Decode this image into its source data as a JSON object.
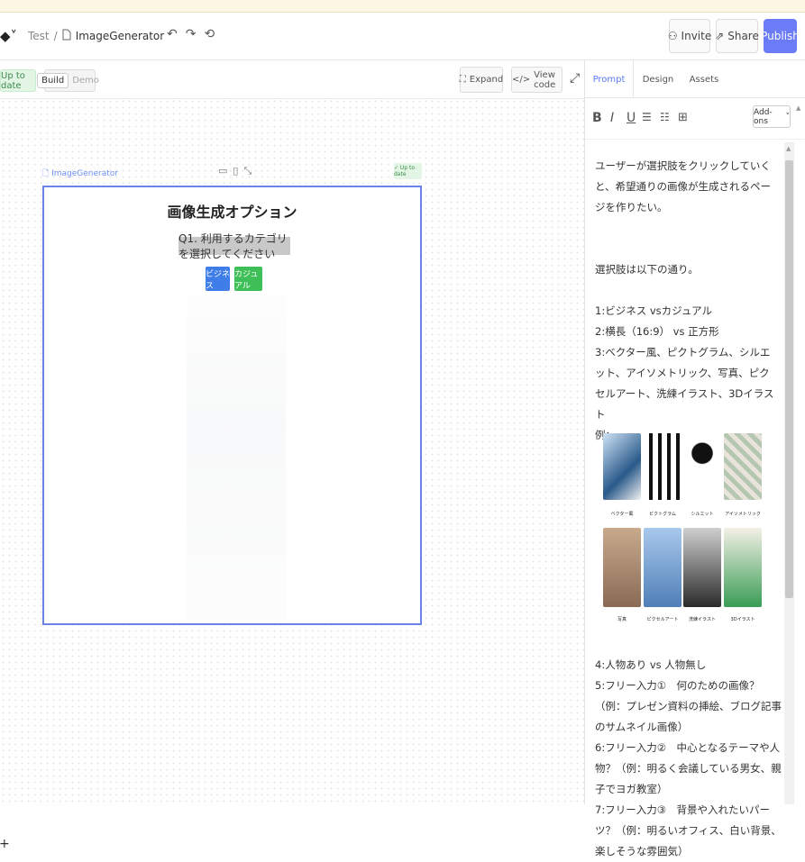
{
  "topbar": {
    "breadcrumb_root": "Test",
    "breadcrumb_sep": "/",
    "project_name": "ImageGenerator",
    "invite_label": "Invite",
    "share_label": "Share",
    "publish_label": "Publish"
  },
  "subbar": {
    "status_label": "Up to date",
    "mode_build": "Build",
    "mode_demo": "Demo",
    "expand_label": "Expand",
    "view_code_label": "View code"
  },
  "frame": {
    "name": "ImageGenerator",
    "badge": "✓ Up to date",
    "title": "画像生成オプション",
    "question": "Q1. 利用するカテゴリを選択してください",
    "choice_business": "ビジネス",
    "choice_casual": "カジュアル"
  },
  "panel": {
    "tabs": [
      "Prompt",
      "Design",
      "Assets"
    ],
    "addons_label": "Add-ons",
    "prompt_lines": [
      "ユーザーが選択肢をクリックしていくと、希望通りの画像が生成されるページを作りたい。",
      "",
      "",
      "選択肢は以下の通り。",
      "",
      "1:ビジネス vsカジュアル",
      "2:横長（16:9） vs 正方形",
      "3:ベクター風、ピクトグラム、シルエット、アイソメトリック、写真、ピクセルアート、洗練イラスト、3Dイラスト",
      "例："
    ],
    "image_captions": [
      "ベクター風",
      "ピクトグラム",
      "シルエット",
      "アイソメトリック",
      "写真",
      "ピクセルアート",
      "洗練イラスト",
      "3Dイラスト"
    ],
    "bottom_lines": [
      "4:人物あり vs 人物無し",
      "5:フリー入力①　何のための画像？　（例：プレゼン資料の挿絵、ブログ記事のサムネイル画像）",
      "6:フリー入力②　中心となるテーマや人物？（例：明るく会議している男女、親子でヨガ教室）",
      "7:フリー入力③　背景や入れたいパーツ？（例：明るいオフィス、白い背景、楽しそうな雰囲気）"
    ]
  },
  "colors": {
    "accent": "#6b7cf6",
    "frame_border": "#6b84ea",
    "business": "#3f7de8",
    "casual": "#3fbf57",
    "status_bg": "#e3f6e6"
  }
}
